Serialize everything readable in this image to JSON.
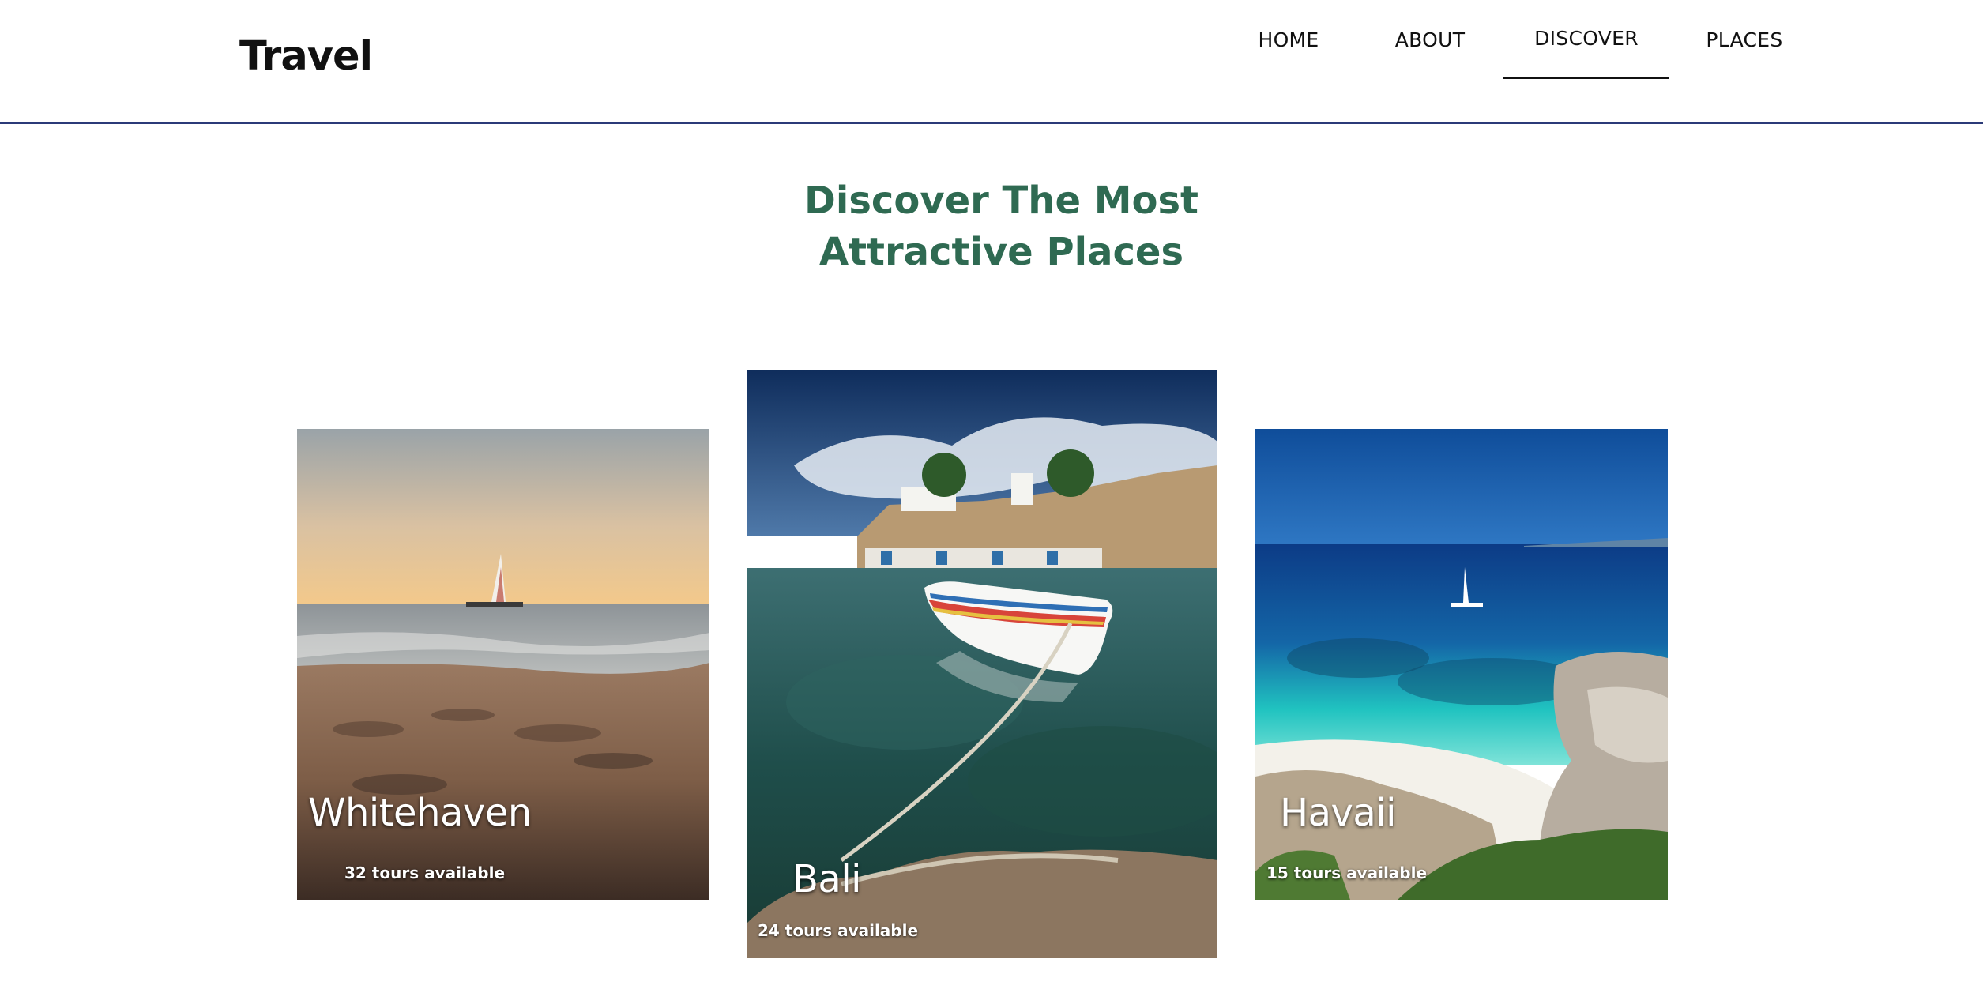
{
  "header": {
    "logo": "Travel",
    "nav": [
      {
        "label": "HOME",
        "active": false
      },
      {
        "label": "ABOUT",
        "active": false
      },
      {
        "label": "DISCOVER",
        "active": true
      },
      {
        "label": "PLACES",
        "active": false
      }
    ]
  },
  "main": {
    "heading_line1": "Discover The Most",
    "heading_line2": "Attractive Places",
    "cards": [
      {
        "name": "Whitehaven",
        "tours": "32 tours available"
      },
      {
        "name": "Bali",
        "tours": "24 tours available"
      },
      {
        "name": "Havaii",
        "tours": "15 tours available"
      }
    ]
  },
  "colors": {
    "heading": "#2f6a52",
    "header_border": "#2b3a78",
    "text": "#111111"
  }
}
